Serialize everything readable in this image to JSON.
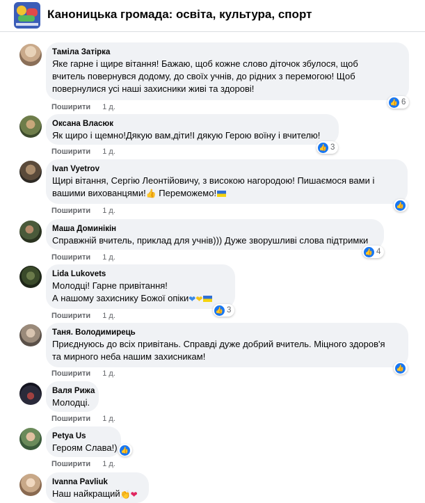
{
  "header": {
    "title": "Каноницька громада: освіта, культура, спорт",
    "logo_icon": "group-logo"
  },
  "share_label": "Поширити",
  "colors": {
    "accent": "#1877f2",
    "bubble": "#f0f2f5",
    "meta": "#65676b"
  },
  "comments": [
    {
      "author": "Таміла Затірка",
      "lines": [
        "Яке гарне і щире вітання! Бажаю, щоб кожне слово діточок збулося, щоб",
        "вчитель повернувся додому, до своїх учнів, до рідних з перемогою! Щоб",
        "повернулися усі наші захисники живі та здорові!"
      ],
      "time": "1 д.",
      "reaction_count": "6"
    },
    {
      "author": "Оксана Власюк",
      "lines": [
        "Як щиро і щемно!Дякую вам,діти!І дякую Герою воїну і вчителю!"
      ],
      "time": "1 д.",
      "reaction_count": "3"
    },
    {
      "author": "Ivan Vyetrov",
      "lines": [
        "Щирі вітання, Сергію Леонтійовичу, з високою нагородою! Пишаємося вами і",
        "вашими вихованцями!",
        "Переможемо!"
      ],
      "time": "1 д.",
      "reaction_count": ""
    },
    {
      "author": "Маша Доминікін",
      "lines": [
        "Справжній вчитель, приклад для учнів))) Дуже зворушливі слова підтримки"
      ],
      "time": "1 д.",
      "reaction_count": "4"
    },
    {
      "author": "Lida Lukovets",
      "lines": [
        "Молодці! Гарне привітання!",
        "А нашому захиснику Божої опіки"
      ],
      "time": "1 д.",
      "reaction_count": "3"
    },
    {
      "author": "Таня. Володимирець",
      "lines": [
        "Приєднуюсь до всіх привітань. Справді дуже добрий вчитель. Міцного здоров'я",
        "та мирного неба нашим захисникам!"
      ],
      "time": "1 д.",
      "reaction_count": ""
    },
    {
      "author": "Валя Рижа",
      "lines": [
        "Молодці."
      ],
      "time": "1 д.",
      "reaction_count": ""
    },
    {
      "author": "Petya Us",
      "lines": [
        "Героям Слава!)"
      ],
      "time": "1 д.",
      "reaction_count": ""
    },
    {
      "author": "Ivanna Pavliuk",
      "lines": [
        "Наш найкращий"
      ],
      "time": "",
      "reaction_count": ""
    }
  ]
}
